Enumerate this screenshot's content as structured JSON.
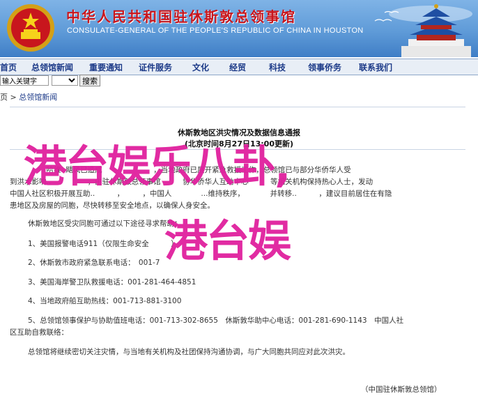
{
  "banner": {
    "title": "中华人民共和国驻休斯敦总领事馆",
    "subtitle": "CONSULATE-GENERAL OF THE PEOPLE'S REPUBLIC OF CHINA IN HOUSTON",
    "colors": {
      "sky": "#5f9bd8",
      "title_red": "#c8161d"
    }
  },
  "nav": {
    "items": [
      "首页",
      "总领馆新闻",
      "重要通知",
      "证件服务",
      "文化",
      "经贸",
      "科技",
      "领事侨务",
      "联系我们"
    ]
  },
  "search": {
    "input_value": "输入关键字",
    "select_value": "",
    "button_label": "搜索"
  },
  "breadcrumb": {
    "prefix": "页 > ",
    "link": "总领馆新闻"
  },
  "article": {
    "title": "休斯敦地区洪灾情况及数据信息通报",
    "date": "(北京时间8月27日13:00更新)",
    "lines": [
      "　　　　　哈维..飓风已造成　　　　　　　，当地政府已展开紧急救援工作，总领馆已与部分华侨华人受",
      "到洪水影响..　　　　　，由驻休斯敦总领事馆　　　协华侨华人互助中心　　　等相关机构保持热心人士，发动",
      "中国人社区积极开展互助..　　　，　　　，中国人　　　　...维持秩序，　　　　并转移..　　　，建议目前居住在有隐",
      "患地区及房屋的同胞，尽快转移至安全地点，以确保人身安全。"
    ],
    "intro": "休斯敦地区受灾同胞可通过以下途径寻求帮助：",
    "items": [
      "1、美国报警电话911（仅限生命安全　　　）",
      "2、休斯敦市政府紧急联系电话：　001-7　　　　",
      "3、美国海岸警卫队救援电话：001-281-464-4851",
      "4、当地政府船互助热线：001-713-881-3100",
      "5、总领馆领事保护与协助值班电话：001-713-302-8655　休斯敦华助中心电话：001-281-690-1143　中国人社",
      "区互助自救联络："
    ],
    "closing": "总领馆将继续密切关注灾情，与当地有关机构及社团保持沟通协调，与广大同胞共同应对此次洪灾。",
    "signature": "（中国驻休斯敦总领馆）"
  },
  "watermark": {
    "line1": "港台娱乐八卦,",
    "line2": "港台娱",
    "color": "#e0209e"
  }
}
